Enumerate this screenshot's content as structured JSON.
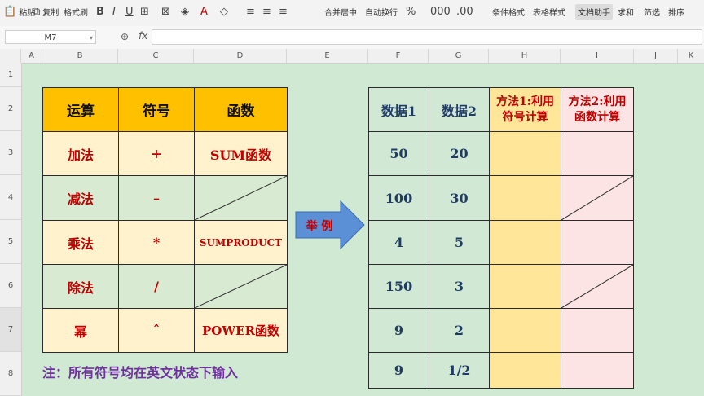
{
  "toolbar": {
    "paste": "粘贴",
    "copy": "复制",
    "format_painter": "格式刷",
    "bold": "B",
    "italic": "I",
    "underline": "U",
    "merge_center": "合并居中",
    "wrap_text": "自动换行",
    "cond_format": "条件格式",
    "table_style": "表格样式",
    "doc_helper": "文档助手",
    "sum": "求和",
    "filter": "筛选",
    "sort": "排序"
  },
  "formula_bar": {
    "name_box": "M7",
    "fx": "fx"
  },
  "columns": [
    "A",
    "B",
    "C",
    "D",
    "E",
    "F",
    "G",
    "H",
    "I",
    "J",
    "K"
  ],
  "rows": [
    "1",
    "2",
    "3",
    "4",
    "5",
    "6",
    "7",
    "8"
  ],
  "left_table": {
    "headers": [
      "运算",
      "符号",
      "函数"
    ],
    "rows": [
      {
        "op": "加法",
        "sym": "+",
        "fn": "SUM函数"
      },
      {
        "op": "减法",
        "sym": "–",
        "fn": ""
      },
      {
        "op": "乘法",
        "sym": "*",
        "fn": "SUMPRODUCT"
      },
      {
        "op": "除法",
        "sym": "/",
        "fn": ""
      },
      {
        "op": "幂",
        "sym": "ˆ",
        "fn": "POWER函数"
      }
    ]
  },
  "note": "注：所有符号均在英文状态下输入",
  "arrow_label": "举 例",
  "right_table": {
    "headers": [
      "数据1",
      "数据2",
      "方法1:利用符号计算",
      "方法2:利用函数计算"
    ],
    "rows": [
      {
        "d1": "50",
        "d2": "20"
      },
      {
        "d1": "100",
        "d2": "30"
      },
      {
        "d1": "4",
        "d2": "5"
      },
      {
        "d1": "150",
        "d2": "3"
      },
      {
        "d1": "9",
        "d2": "2"
      },
      {
        "d1": "9",
        "d2": "1/2"
      }
    ]
  },
  "colors": {
    "header_orange": "#ffc000",
    "red_text": "#c00000",
    "navy_text": "#1f3b64",
    "note_purple": "#7030a0",
    "arrow_blue": "#5b8fd6"
  }
}
